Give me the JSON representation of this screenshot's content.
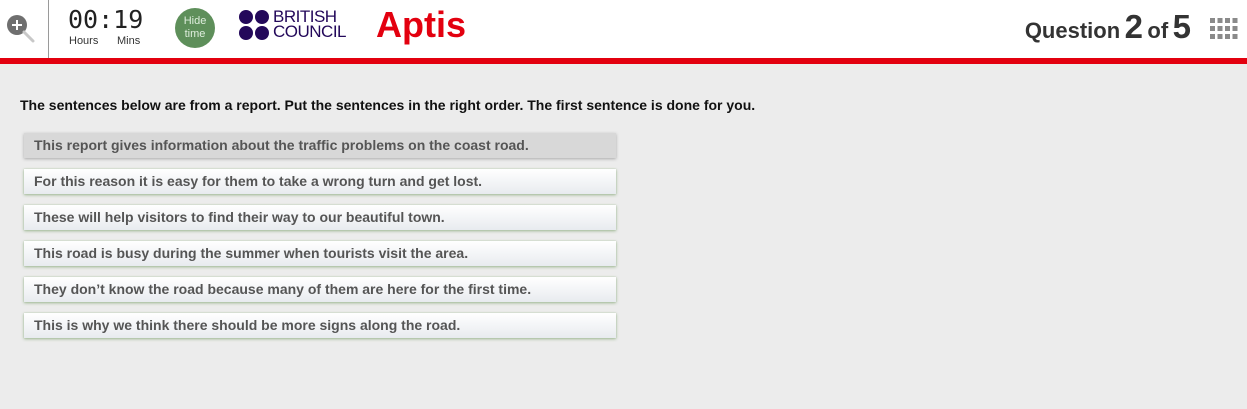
{
  "header": {
    "timer": {
      "value": "00:19",
      "hours_label": "Hours",
      "mins_label": "Mins"
    },
    "hide_time_label": "Hide time",
    "brand": {
      "british_council_line1": "BRITISH",
      "british_council_line2": "COUNCIL",
      "aptis": "Aptis"
    },
    "question_counter": {
      "prefix": "Question",
      "current": "2",
      "of": "of",
      "total": "5"
    },
    "icons": {
      "zoom": "zoom-in-icon",
      "navigator": "grid-icon"
    },
    "colors": {
      "accent_red": "#e3000f",
      "hide_time_bg": "#5e8f5a",
      "brand_blue": "#23085a"
    }
  },
  "main": {
    "instructions": "The sentences below are from a report. Put the sentences in the right order. The first sentence is done for you.",
    "sentences": [
      "This report gives information about the traffic problems on the coast road.",
      "For this reason it is easy for them to take a wrong turn and get lost.",
      "These will help visitors to find their way to our beautiful town.",
      "This road is busy during the summer when tourists visit the area.",
      "They don’t know the road because many of them are here for the first time.",
      "This is why we think there should be more signs along the road."
    ]
  }
}
